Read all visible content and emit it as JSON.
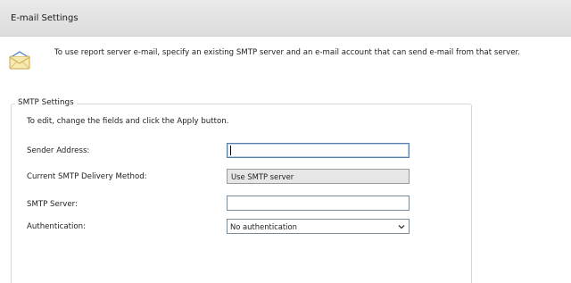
{
  "header": {
    "title": "E-mail Settings"
  },
  "intro": {
    "icon": "envelope-icon",
    "text": "To use report server e-mail, specify an existing SMTP server and an e-mail account that can send e-mail from that server."
  },
  "smtp": {
    "legend": "SMTP Settings",
    "help": "To edit, change the fields and click the Apply button.",
    "sender": {
      "label": "Sender Address:",
      "value": ""
    },
    "delivery": {
      "label": "Current SMTP Delivery Method:",
      "value": "Use SMTP server"
    },
    "server": {
      "label": "SMTP Server:",
      "value": ""
    },
    "auth": {
      "label": "Authentication:",
      "value": "No authentication"
    }
  }
}
